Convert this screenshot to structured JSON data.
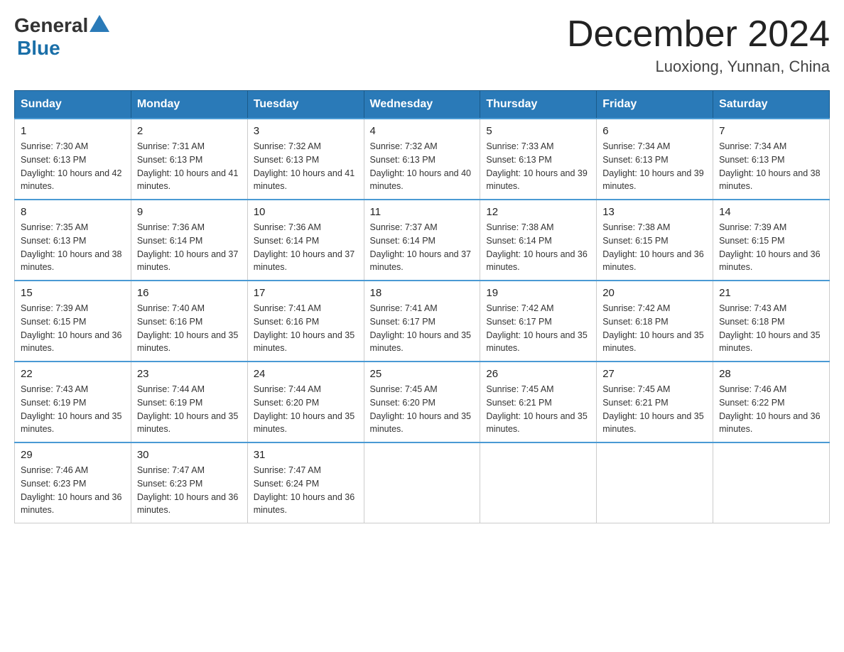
{
  "logo": {
    "general": "General",
    "blue": "Blue"
  },
  "title": {
    "month": "December 2024",
    "location": "Luoxiong, Yunnan, China"
  },
  "headers": [
    "Sunday",
    "Monday",
    "Tuesday",
    "Wednesday",
    "Thursday",
    "Friday",
    "Saturday"
  ],
  "weeks": [
    [
      {
        "day": "1",
        "sunrise": "7:30 AM",
        "sunset": "6:13 PM",
        "daylight": "10 hours and 42 minutes."
      },
      {
        "day": "2",
        "sunrise": "7:31 AM",
        "sunset": "6:13 PM",
        "daylight": "10 hours and 41 minutes."
      },
      {
        "day": "3",
        "sunrise": "7:32 AM",
        "sunset": "6:13 PM",
        "daylight": "10 hours and 41 minutes."
      },
      {
        "day": "4",
        "sunrise": "7:32 AM",
        "sunset": "6:13 PM",
        "daylight": "10 hours and 40 minutes."
      },
      {
        "day": "5",
        "sunrise": "7:33 AM",
        "sunset": "6:13 PM",
        "daylight": "10 hours and 39 minutes."
      },
      {
        "day": "6",
        "sunrise": "7:34 AM",
        "sunset": "6:13 PM",
        "daylight": "10 hours and 39 minutes."
      },
      {
        "day": "7",
        "sunrise": "7:34 AM",
        "sunset": "6:13 PM",
        "daylight": "10 hours and 38 minutes."
      }
    ],
    [
      {
        "day": "8",
        "sunrise": "7:35 AM",
        "sunset": "6:13 PM",
        "daylight": "10 hours and 38 minutes."
      },
      {
        "day": "9",
        "sunrise": "7:36 AM",
        "sunset": "6:14 PM",
        "daylight": "10 hours and 37 minutes."
      },
      {
        "day": "10",
        "sunrise": "7:36 AM",
        "sunset": "6:14 PM",
        "daylight": "10 hours and 37 minutes."
      },
      {
        "day": "11",
        "sunrise": "7:37 AM",
        "sunset": "6:14 PM",
        "daylight": "10 hours and 37 minutes."
      },
      {
        "day": "12",
        "sunrise": "7:38 AM",
        "sunset": "6:14 PM",
        "daylight": "10 hours and 36 minutes."
      },
      {
        "day": "13",
        "sunrise": "7:38 AM",
        "sunset": "6:15 PM",
        "daylight": "10 hours and 36 minutes."
      },
      {
        "day": "14",
        "sunrise": "7:39 AM",
        "sunset": "6:15 PM",
        "daylight": "10 hours and 36 minutes."
      }
    ],
    [
      {
        "day": "15",
        "sunrise": "7:39 AM",
        "sunset": "6:15 PM",
        "daylight": "10 hours and 36 minutes."
      },
      {
        "day": "16",
        "sunrise": "7:40 AM",
        "sunset": "6:16 PM",
        "daylight": "10 hours and 35 minutes."
      },
      {
        "day": "17",
        "sunrise": "7:41 AM",
        "sunset": "6:16 PM",
        "daylight": "10 hours and 35 minutes."
      },
      {
        "day": "18",
        "sunrise": "7:41 AM",
        "sunset": "6:17 PM",
        "daylight": "10 hours and 35 minutes."
      },
      {
        "day": "19",
        "sunrise": "7:42 AM",
        "sunset": "6:17 PM",
        "daylight": "10 hours and 35 minutes."
      },
      {
        "day": "20",
        "sunrise": "7:42 AM",
        "sunset": "6:18 PM",
        "daylight": "10 hours and 35 minutes."
      },
      {
        "day": "21",
        "sunrise": "7:43 AM",
        "sunset": "6:18 PM",
        "daylight": "10 hours and 35 minutes."
      }
    ],
    [
      {
        "day": "22",
        "sunrise": "7:43 AM",
        "sunset": "6:19 PM",
        "daylight": "10 hours and 35 minutes."
      },
      {
        "day": "23",
        "sunrise": "7:44 AM",
        "sunset": "6:19 PM",
        "daylight": "10 hours and 35 minutes."
      },
      {
        "day": "24",
        "sunrise": "7:44 AM",
        "sunset": "6:20 PM",
        "daylight": "10 hours and 35 minutes."
      },
      {
        "day": "25",
        "sunrise": "7:45 AM",
        "sunset": "6:20 PM",
        "daylight": "10 hours and 35 minutes."
      },
      {
        "day": "26",
        "sunrise": "7:45 AM",
        "sunset": "6:21 PM",
        "daylight": "10 hours and 35 minutes."
      },
      {
        "day": "27",
        "sunrise": "7:45 AM",
        "sunset": "6:21 PM",
        "daylight": "10 hours and 35 minutes."
      },
      {
        "day": "28",
        "sunrise": "7:46 AM",
        "sunset": "6:22 PM",
        "daylight": "10 hours and 36 minutes."
      }
    ],
    [
      {
        "day": "29",
        "sunrise": "7:46 AM",
        "sunset": "6:23 PM",
        "daylight": "10 hours and 36 minutes."
      },
      {
        "day": "30",
        "sunrise": "7:47 AM",
        "sunset": "6:23 PM",
        "daylight": "10 hours and 36 minutes."
      },
      {
        "day": "31",
        "sunrise": "7:47 AM",
        "sunset": "6:24 PM",
        "daylight": "10 hours and 36 minutes."
      },
      null,
      null,
      null,
      null
    ]
  ],
  "colors": {
    "header_bg": "#2a7ab8",
    "header_border": "#1a5a8a",
    "row_top_border": "#4a9ad4",
    "logo_blue": "#1a6fa8"
  }
}
